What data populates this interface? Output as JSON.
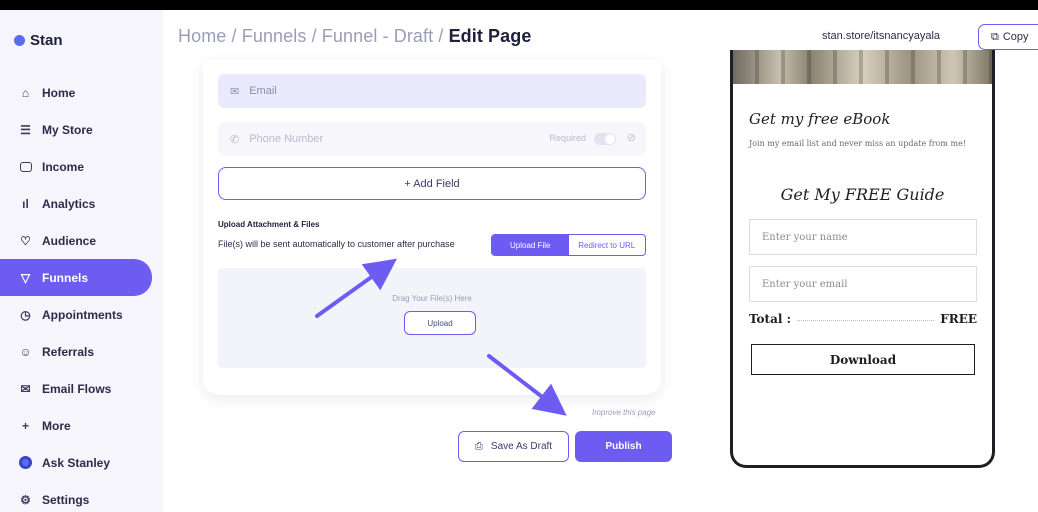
{
  "brand": {
    "name": "Stan"
  },
  "sidebar": {
    "items": [
      {
        "label": "Home",
        "icon": "home-icon",
        "glyph": "⌂"
      },
      {
        "label": "My Store",
        "icon": "store-icon",
        "glyph": "☰"
      },
      {
        "label": "Income",
        "icon": "income-icon",
        "glyph": ""
      },
      {
        "label": "Analytics",
        "icon": "analytics-icon",
        "glyph": "ıl"
      },
      {
        "label": "Audience",
        "icon": "heart-icon",
        "glyph": "♡"
      },
      {
        "label": "Funnels",
        "icon": "funnel-icon",
        "glyph": "▽",
        "active": true
      },
      {
        "label": "Appointments",
        "icon": "clock-icon",
        "glyph": "◷"
      },
      {
        "label": "Referrals",
        "icon": "referral-icon",
        "glyph": "☺"
      },
      {
        "label": "Email Flows",
        "icon": "mail-icon",
        "glyph": "✉"
      },
      {
        "label": "More",
        "icon": "plus-icon",
        "glyph": "+"
      },
      {
        "label": "Ask Stanley",
        "icon": "stanley-icon",
        "glyph": ""
      },
      {
        "label": "Settings",
        "icon": "settings-icon",
        "glyph": "⚙"
      }
    ]
  },
  "header": {
    "breadcrumb": [
      "Home",
      "Funnels",
      "Funnel - Draft"
    ],
    "separator": " / ",
    "current": "Edit Page",
    "store_url": "stan.store/itsnancyayala",
    "copy_label": "Copy"
  },
  "form": {
    "email_placeholder": "Email",
    "phone_placeholder": "Phone Number",
    "required_label": "Required",
    "add_field_label": "+ Add Field",
    "upload_title": "Upload Attachment & Files",
    "upload_desc": "File(s) will be sent automatically to customer after purchase",
    "options": [
      "Upload File",
      "Redirect to URL"
    ],
    "selected_option": "Upload File",
    "drop_text": "Drag Your File(s) Here",
    "upload_btn": "Upload"
  },
  "footer": {
    "improve_label": "Improve this page",
    "save_draft_label": "Save As Draft",
    "publish_label": "Publish"
  },
  "preview": {
    "title": "Get my free eBook",
    "desc": "Join my email list and never miss an update from me!",
    "guide_title": "Get My FREE Guide",
    "name_placeholder": "Enter your name",
    "email_placeholder": "Enter your email",
    "total_label": "Total :",
    "total_value": "FREE",
    "download_label": "Download"
  },
  "colors": {
    "accent": "#6c5cf2",
    "sidebar_bg": "#f5f5fb",
    "arrow": "#6c5cf2"
  }
}
